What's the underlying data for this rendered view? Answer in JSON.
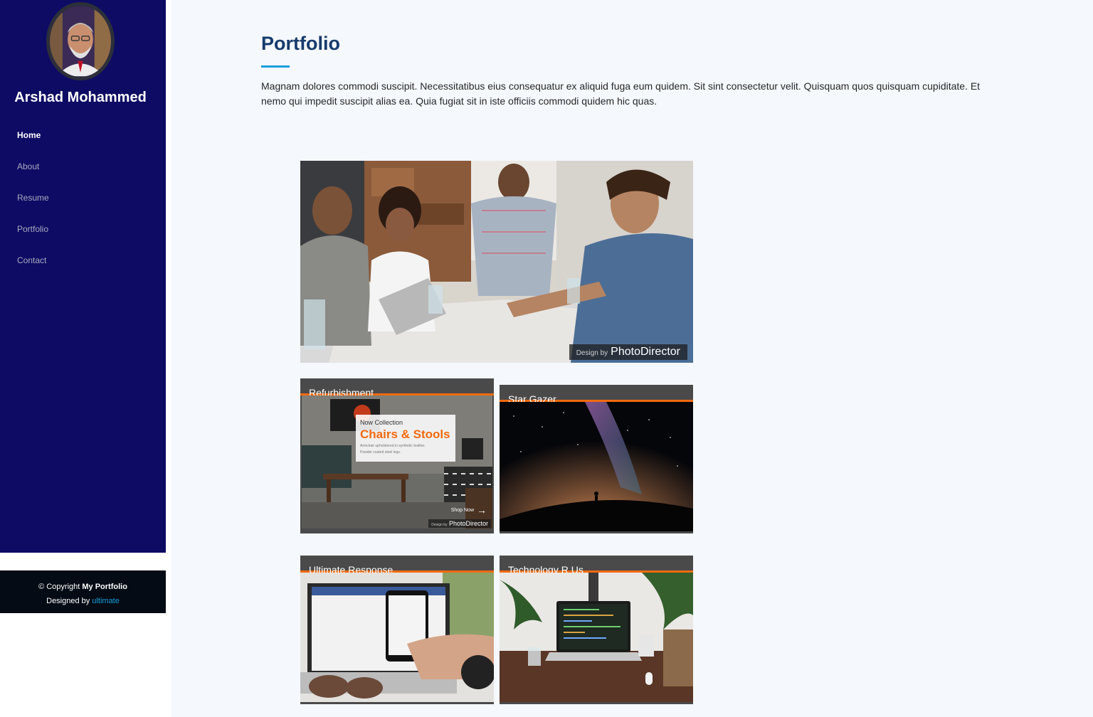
{
  "profile": {
    "name": "Arshad Mohammed"
  },
  "nav": {
    "items": [
      {
        "label": "Home",
        "active": true
      },
      {
        "label": "About",
        "active": false
      },
      {
        "label": "Resume",
        "active": false
      },
      {
        "label": "Portfolio",
        "active": false
      },
      {
        "label": "Contact",
        "active": false
      }
    ]
  },
  "footer": {
    "copyright_prefix": "© Copyright",
    "site_name": "My Portfolio",
    "designed_by_prefix": "Designed by",
    "designer_link": "ultimate"
  },
  "section": {
    "title": "Portfolio",
    "description": "Magnam dolores commodi suscipit. Necessitatibus eius consequatur ex aliquid fuga eum quidem. Sit sint consectetur velit. Quisquam quos quisquam cupiditate. Et nemo qui impedit suscipit alias ea. Quia fugiat sit in iste officiis commodi quidem hic quas."
  },
  "hero": {
    "watermark_prefix": "Design by",
    "watermark_brand": "PhotoDirector"
  },
  "portfolio": {
    "items": [
      {
        "title": "Refurbishment",
        "image": {
          "collection_label": "Now Collection",
          "headline": "Chairs & Stools",
          "subtext_line1": "Armchair upholstered in synthetic leather.",
          "subtext_line2": "Powder coated steel legs.",
          "cta": "Shop Now",
          "watermark_prefix": "Design by",
          "watermark_brand": "PhotoDirector"
        }
      },
      {
        "title": "Star Gazer"
      },
      {
        "title": "Ultimate Response"
      },
      {
        "title": "Technology R Us"
      }
    ]
  },
  "colors": {
    "sidebar_bg": "#0e0b64",
    "accent": "#149ddd",
    "card_accent": "#f26a0f",
    "title": "#173b6c"
  },
  "icons": {
    "shop_now_arrow": "arrow-right-icon"
  }
}
